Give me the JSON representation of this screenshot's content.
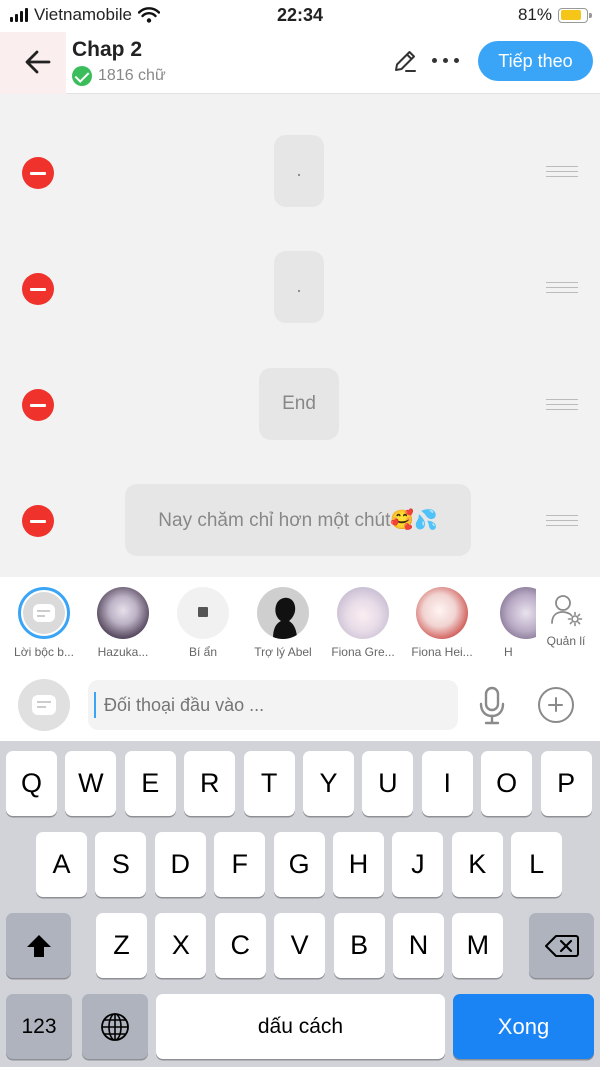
{
  "status_bar": {
    "carrier": "Vietnamobile",
    "time": "22:34",
    "battery_percent": "81%",
    "battery_level": 0.81,
    "battery_color": "#f5c518"
  },
  "header": {
    "title": "Chap 2",
    "word_count": "1816 chữ",
    "next_label": "Tiếp theo",
    "back_icon": "arrow-left-icon",
    "edit_icon": "pencil-icon",
    "more_icon": "more-dots-icon",
    "accent_color": "#3aa5f7"
  },
  "rows": [
    {
      "text": "."
    },
    {
      "text": "."
    },
    {
      "text": "End"
    },
    {
      "text": "Nay chăm chỉ hơn một chút🥰💦"
    }
  ],
  "characters": [
    {
      "name": "Lời bộc b..."
    },
    {
      "name": "Hazuka..."
    },
    {
      "name": "Bí ẩn"
    },
    {
      "name": "Trợ lý Abel"
    },
    {
      "name": "Fiona Gre..."
    },
    {
      "name": "Fiona Hei..."
    },
    {
      "name": "H"
    }
  ],
  "manage_label": "Quản lí",
  "input": {
    "placeholder": "Đối thoại đầu vào ..."
  },
  "keyboard": {
    "row1": [
      "Q",
      "W",
      "E",
      "R",
      "T",
      "Y",
      "U",
      "I",
      "O",
      "P"
    ],
    "row2": [
      "A",
      "S",
      "D",
      "F",
      "G",
      "H",
      "J",
      "K",
      "L"
    ],
    "row3": [
      "Z",
      "X",
      "C",
      "V",
      "B",
      "N",
      "M"
    ],
    "numbers_label": "123",
    "space_label": "dấu cách",
    "done_label": "Xong"
  }
}
